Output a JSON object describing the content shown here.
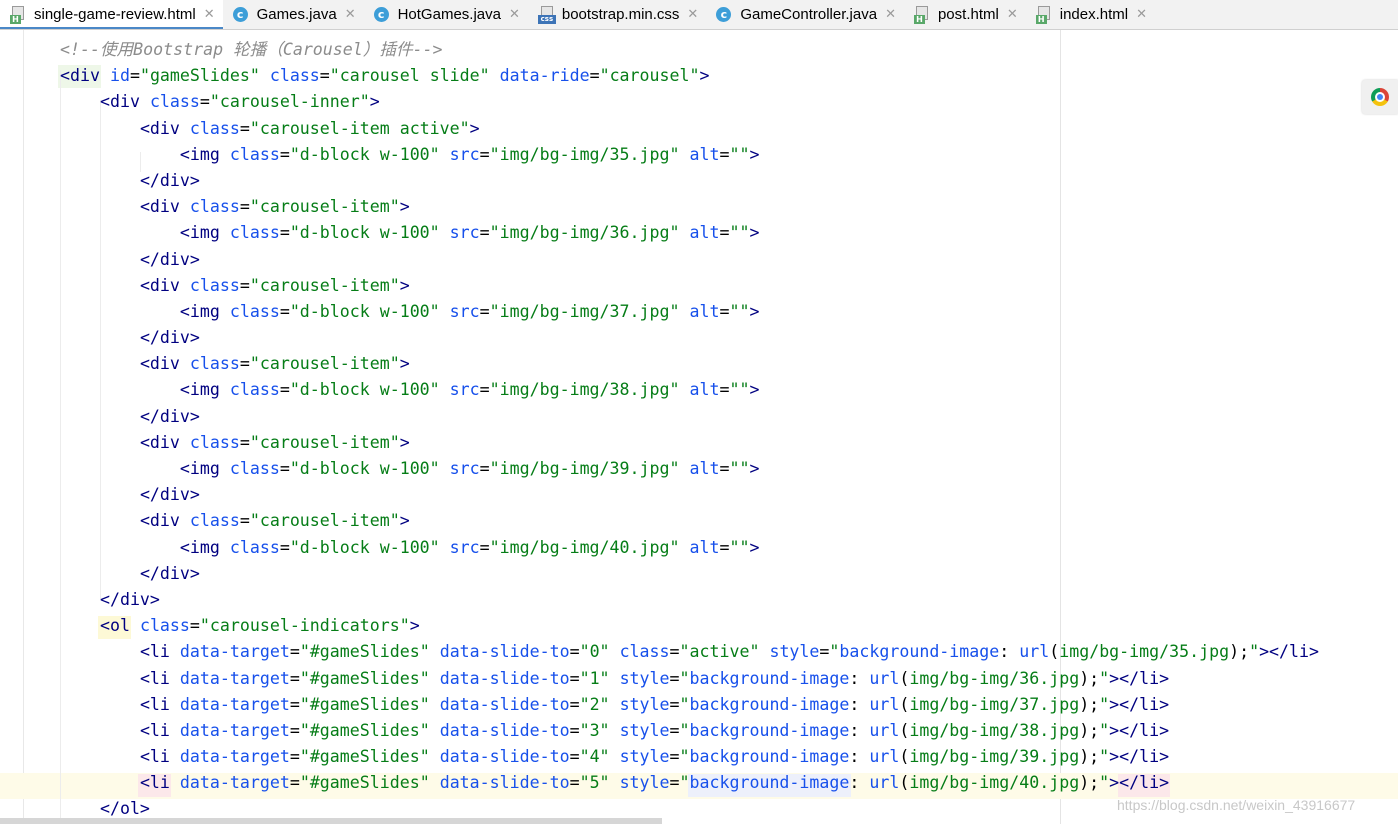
{
  "tabs": [
    {
      "label": "single-game-review.html",
      "icon": "html-file-icon",
      "active": true
    },
    {
      "label": "Games.java",
      "icon": "java-class-icon"
    },
    {
      "label": "HotGames.java",
      "icon": "java-class-icon"
    },
    {
      "label": "bootstrap.min.css",
      "icon": "css-file-icon"
    },
    {
      "label": "GameController.java",
      "icon": "java-class-icon"
    },
    {
      "label": "post.html",
      "icon": "html-file-icon"
    },
    {
      "label": "index.html",
      "icon": "html-file-icon"
    }
  ],
  "editor": {
    "cut_top_line": "    ",
    "lines": [
      [
        [
          "cmt",
          "<!--使用Bootstrap 轮播（Carousel）插件-->"
        ]
      ],
      [
        [
          "tag",
          "<div"
        ],
        [
          "txt",
          " "
        ],
        [
          "attr",
          "id"
        ],
        [
          "txt",
          "="
        ],
        [
          "val",
          "\"gameSlides\""
        ],
        [
          "txt",
          " "
        ],
        [
          "attr",
          "class"
        ],
        [
          "txt",
          "="
        ],
        [
          "val",
          "\"carousel slide\""
        ],
        [
          "txt",
          " "
        ],
        [
          "attr",
          "data-ride"
        ],
        [
          "txt",
          "="
        ],
        [
          "val",
          "\"carousel\""
        ],
        [
          "tag",
          ">"
        ]
      ],
      [
        [
          "txt",
          "    "
        ],
        [
          "tag",
          "<div"
        ],
        [
          "txt",
          " "
        ],
        [
          "attr",
          "class"
        ],
        [
          "txt",
          "="
        ],
        [
          "val",
          "\"carousel-inner\""
        ],
        [
          "tag",
          ">"
        ]
      ],
      [
        [
          "txt",
          "        "
        ],
        [
          "tag",
          "<div"
        ],
        [
          "txt",
          " "
        ],
        [
          "attr",
          "class"
        ],
        [
          "txt",
          "="
        ],
        [
          "val",
          "\"carousel-item active\""
        ],
        [
          "tag",
          ">"
        ]
      ],
      [
        [
          "txt",
          "            "
        ],
        [
          "tag",
          "<img"
        ],
        [
          "txt",
          " "
        ],
        [
          "attr",
          "class"
        ],
        [
          "txt",
          "="
        ],
        [
          "val",
          "\"d-block w-100\""
        ],
        [
          "txt",
          " "
        ],
        [
          "attr",
          "src"
        ],
        [
          "txt",
          "="
        ],
        [
          "val",
          "\"img/bg-img/35.jpg\""
        ],
        [
          "txt",
          " "
        ],
        [
          "attr",
          "alt"
        ],
        [
          "txt",
          "="
        ],
        [
          "val",
          "\"\""
        ],
        [
          "tag",
          ">"
        ]
      ],
      [
        [
          "txt",
          "        "
        ],
        [
          "tag",
          "</div>"
        ]
      ],
      [
        [
          "txt",
          "        "
        ],
        [
          "tag",
          "<div"
        ],
        [
          "txt",
          " "
        ],
        [
          "attr",
          "class"
        ],
        [
          "txt",
          "="
        ],
        [
          "val",
          "\"carousel-item\""
        ],
        [
          "tag",
          ">"
        ]
      ],
      [
        [
          "txt",
          "            "
        ],
        [
          "tag",
          "<img"
        ],
        [
          "txt",
          " "
        ],
        [
          "attr",
          "class"
        ],
        [
          "txt",
          "="
        ],
        [
          "val",
          "\"d-block w-100\""
        ],
        [
          "txt",
          " "
        ],
        [
          "attr",
          "src"
        ],
        [
          "txt",
          "="
        ],
        [
          "val",
          "\"img/bg-img/36.jpg\""
        ],
        [
          "txt",
          " "
        ],
        [
          "attr",
          "alt"
        ],
        [
          "txt",
          "="
        ],
        [
          "val",
          "\"\""
        ],
        [
          "tag",
          ">"
        ]
      ],
      [
        [
          "txt",
          "        "
        ],
        [
          "tag",
          "</div>"
        ]
      ],
      [
        [
          "txt",
          "        "
        ],
        [
          "tag",
          "<div"
        ],
        [
          "txt",
          " "
        ],
        [
          "attr",
          "class"
        ],
        [
          "txt",
          "="
        ],
        [
          "val",
          "\"carousel-item\""
        ],
        [
          "tag",
          ">"
        ]
      ],
      [
        [
          "txt",
          "            "
        ],
        [
          "tag",
          "<img"
        ],
        [
          "txt",
          " "
        ],
        [
          "attr",
          "class"
        ],
        [
          "txt",
          "="
        ],
        [
          "val",
          "\"d-block w-100\""
        ],
        [
          "txt",
          " "
        ],
        [
          "attr",
          "src"
        ],
        [
          "txt",
          "="
        ],
        [
          "val",
          "\"img/bg-img/37.jpg\""
        ],
        [
          "txt",
          " "
        ],
        [
          "attr",
          "alt"
        ],
        [
          "txt",
          "="
        ],
        [
          "val",
          "\"\""
        ],
        [
          "tag",
          ">"
        ]
      ],
      [
        [
          "txt",
          "        "
        ],
        [
          "tag",
          "</div>"
        ]
      ],
      [
        [
          "txt",
          "        "
        ],
        [
          "tag",
          "<div"
        ],
        [
          "txt",
          " "
        ],
        [
          "attr",
          "class"
        ],
        [
          "txt",
          "="
        ],
        [
          "val",
          "\"carousel-item\""
        ],
        [
          "tag",
          ">"
        ]
      ],
      [
        [
          "txt",
          "            "
        ],
        [
          "tag",
          "<img"
        ],
        [
          "txt",
          " "
        ],
        [
          "attr",
          "class"
        ],
        [
          "txt",
          "="
        ],
        [
          "val",
          "\"d-block w-100\""
        ],
        [
          "txt",
          " "
        ],
        [
          "attr",
          "src"
        ],
        [
          "txt",
          "="
        ],
        [
          "val",
          "\"img/bg-img/38.jpg\""
        ],
        [
          "txt",
          " "
        ],
        [
          "attr",
          "alt"
        ],
        [
          "txt",
          "="
        ],
        [
          "val",
          "\"\""
        ],
        [
          "tag",
          ">"
        ]
      ],
      [
        [
          "txt",
          "        "
        ],
        [
          "tag",
          "</div>"
        ]
      ],
      [
        [
          "txt",
          "        "
        ],
        [
          "tag",
          "<div"
        ],
        [
          "txt",
          " "
        ],
        [
          "attr",
          "class"
        ],
        [
          "txt",
          "="
        ],
        [
          "val",
          "\"carousel-item\""
        ],
        [
          "tag",
          ">"
        ]
      ],
      [
        [
          "txt",
          "            "
        ],
        [
          "tag",
          "<img"
        ],
        [
          "txt",
          " "
        ],
        [
          "attr",
          "class"
        ],
        [
          "txt",
          "="
        ],
        [
          "val",
          "\"d-block w-100\""
        ],
        [
          "txt",
          " "
        ],
        [
          "attr",
          "src"
        ],
        [
          "txt",
          "="
        ],
        [
          "val",
          "\"img/bg-img/39.jpg\""
        ],
        [
          "txt",
          " "
        ],
        [
          "attr",
          "alt"
        ],
        [
          "txt",
          "="
        ],
        [
          "val",
          "\"\""
        ],
        [
          "tag",
          ">"
        ]
      ],
      [
        [
          "txt",
          "        "
        ],
        [
          "tag",
          "</div>"
        ]
      ],
      [
        [
          "txt",
          "        "
        ],
        [
          "tag",
          "<div"
        ],
        [
          "txt",
          " "
        ],
        [
          "attr",
          "class"
        ],
        [
          "txt",
          "="
        ],
        [
          "val",
          "\"carousel-item\""
        ],
        [
          "tag",
          ">"
        ]
      ],
      [
        [
          "txt",
          "            "
        ],
        [
          "tag",
          "<img"
        ],
        [
          "txt",
          " "
        ],
        [
          "attr",
          "class"
        ],
        [
          "txt",
          "="
        ],
        [
          "val",
          "\"d-block w-100\""
        ],
        [
          "txt",
          " "
        ],
        [
          "attr",
          "src"
        ],
        [
          "txt",
          "="
        ],
        [
          "val",
          "\"img/bg-img/40.jpg\""
        ],
        [
          "txt",
          " "
        ],
        [
          "attr",
          "alt"
        ],
        [
          "txt",
          "="
        ],
        [
          "val",
          "\"\""
        ],
        [
          "tag",
          ">"
        ]
      ],
      [
        [
          "txt",
          "        "
        ],
        [
          "tag",
          "</div>"
        ]
      ],
      [
        [
          "txt",
          "    "
        ],
        [
          "tag",
          "</div>"
        ]
      ],
      [
        [
          "txt",
          "    "
        ],
        [
          "tag",
          "<ol"
        ],
        [
          "txt",
          " "
        ],
        [
          "attr",
          "class"
        ],
        [
          "txt",
          "="
        ],
        [
          "val",
          "\"carousel-indicators\""
        ],
        [
          "tag",
          ">"
        ]
      ],
      [
        [
          "txt",
          "        "
        ],
        [
          "tag",
          "<li"
        ],
        [
          "txt",
          " "
        ],
        [
          "attr",
          "data-target"
        ],
        [
          "txt",
          "="
        ],
        [
          "val",
          "\"#gameSlides\""
        ],
        [
          "txt",
          " "
        ],
        [
          "attr",
          "data-slide-to"
        ],
        [
          "txt",
          "="
        ],
        [
          "val",
          "\"0\""
        ],
        [
          "txt",
          " "
        ],
        [
          "attr",
          "class"
        ],
        [
          "txt",
          "="
        ],
        [
          "val",
          "\"active\""
        ],
        [
          "txt",
          " "
        ],
        [
          "attr",
          "style"
        ],
        [
          "txt",
          "="
        ],
        [
          "val",
          "\""
        ],
        [
          "attr",
          "background-image"
        ],
        [
          "txt",
          ": "
        ],
        [
          "attr",
          "url"
        ],
        [
          "txt",
          "("
        ],
        [
          "val",
          "img/bg-img/35.jpg"
        ],
        [
          "txt",
          ");"
        ],
        [
          "val",
          "\""
        ],
        [
          "tag",
          "></li>"
        ]
      ],
      [
        [
          "txt",
          "        "
        ],
        [
          "tag",
          "<li"
        ],
        [
          "txt",
          " "
        ],
        [
          "attr",
          "data-target"
        ],
        [
          "txt",
          "="
        ],
        [
          "val",
          "\"#gameSlides\""
        ],
        [
          "txt",
          " "
        ],
        [
          "attr",
          "data-slide-to"
        ],
        [
          "txt",
          "="
        ],
        [
          "val",
          "\"1\""
        ],
        [
          "txt",
          " "
        ],
        [
          "attr",
          "style"
        ],
        [
          "txt",
          "="
        ],
        [
          "val",
          "\""
        ],
        [
          "attr",
          "background-image"
        ],
        [
          "txt",
          ": "
        ],
        [
          "attr",
          "url"
        ],
        [
          "txt",
          "("
        ],
        [
          "val",
          "img/bg-img/36.jpg"
        ],
        [
          "txt",
          ");"
        ],
        [
          "val",
          "\""
        ],
        [
          "tag",
          "></li>"
        ]
      ],
      [
        [
          "txt",
          "        "
        ],
        [
          "tag",
          "<li"
        ],
        [
          "txt",
          " "
        ],
        [
          "attr",
          "data-target"
        ],
        [
          "txt",
          "="
        ],
        [
          "val",
          "\"#gameSlides\""
        ],
        [
          "txt",
          " "
        ],
        [
          "attr",
          "data-slide-to"
        ],
        [
          "txt",
          "="
        ],
        [
          "val",
          "\"2\""
        ],
        [
          "txt",
          " "
        ],
        [
          "attr",
          "style"
        ],
        [
          "txt",
          "="
        ],
        [
          "val",
          "\""
        ],
        [
          "attr",
          "background-image"
        ],
        [
          "txt",
          ": "
        ],
        [
          "attr",
          "url"
        ],
        [
          "txt",
          "("
        ],
        [
          "val",
          "img/bg-img/37.jpg"
        ],
        [
          "txt",
          ");"
        ],
        [
          "val",
          "\""
        ],
        [
          "tag",
          "></li>"
        ]
      ],
      [
        [
          "txt",
          "        "
        ],
        [
          "tag",
          "<li"
        ],
        [
          "txt",
          " "
        ],
        [
          "attr",
          "data-target"
        ],
        [
          "txt",
          "="
        ],
        [
          "val",
          "\"#gameSlides\""
        ],
        [
          "txt",
          " "
        ],
        [
          "attr",
          "data-slide-to"
        ],
        [
          "txt",
          "="
        ],
        [
          "val",
          "\"3\""
        ],
        [
          "txt",
          " "
        ],
        [
          "attr",
          "style"
        ],
        [
          "txt",
          "="
        ],
        [
          "val",
          "\""
        ],
        [
          "attr",
          "background-image"
        ],
        [
          "txt",
          ": "
        ],
        [
          "attr",
          "url"
        ],
        [
          "txt",
          "("
        ],
        [
          "val",
          "img/bg-img/38.jpg"
        ],
        [
          "txt",
          ");"
        ],
        [
          "val",
          "\""
        ],
        [
          "tag",
          "></li>"
        ]
      ],
      [
        [
          "txt",
          "        "
        ],
        [
          "tag",
          "<li"
        ],
        [
          "txt",
          " "
        ],
        [
          "attr",
          "data-target"
        ],
        [
          "txt",
          "="
        ],
        [
          "val",
          "\"#gameSlides\""
        ],
        [
          "txt",
          " "
        ],
        [
          "attr",
          "data-slide-to"
        ],
        [
          "txt",
          "="
        ],
        [
          "val",
          "\"4\""
        ],
        [
          "txt",
          " "
        ],
        [
          "attr",
          "style"
        ],
        [
          "txt",
          "="
        ],
        [
          "val",
          "\""
        ],
        [
          "attr",
          "background-image"
        ],
        [
          "txt",
          ": "
        ],
        [
          "attr",
          "url"
        ],
        [
          "txt",
          "("
        ],
        [
          "val",
          "img/bg-img/39.jpg"
        ],
        [
          "txt",
          ");"
        ],
        [
          "val",
          "\""
        ],
        [
          "tag",
          "></li>"
        ]
      ],
      [
        [
          "txt",
          "        "
        ],
        [
          "tag",
          "<li"
        ],
        [
          "txt",
          " "
        ],
        [
          "attr",
          "data-target"
        ],
        [
          "txt",
          "="
        ],
        [
          "val",
          "\"#gameSlides\""
        ],
        [
          "txt",
          " "
        ],
        [
          "attr",
          "data-slide-to"
        ],
        [
          "txt",
          "="
        ],
        [
          "val",
          "\"5\""
        ],
        [
          "txt",
          " "
        ],
        [
          "attr",
          "style"
        ],
        [
          "txt",
          "="
        ],
        [
          "val",
          "\""
        ],
        [
          "attr",
          "background-image"
        ],
        [
          "txt",
          ": "
        ],
        [
          "attr",
          "url"
        ],
        [
          "txt",
          "("
        ],
        [
          "val",
          "img/bg-img/40.jpg"
        ],
        [
          "txt",
          ");"
        ],
        [
          "val",
          "\""
        ],
        [
          "tag",
          "></li>"
        ]
      ],
      [
        [
          "txt",
          "    "
        ],
        [
          "tag",
          "</ol>"
        ]
      ]
    ]
  },
  "watermark": "https://blog.csdn.net/weixin_43916677",
  "colors": {
    "tag": "#000080",
    "attribute": "#1750eb",
    "value": "#067d17",
    "comment": "#8c8c8c",
    "active_tab_underline": "#4a88c7"
  }
}
